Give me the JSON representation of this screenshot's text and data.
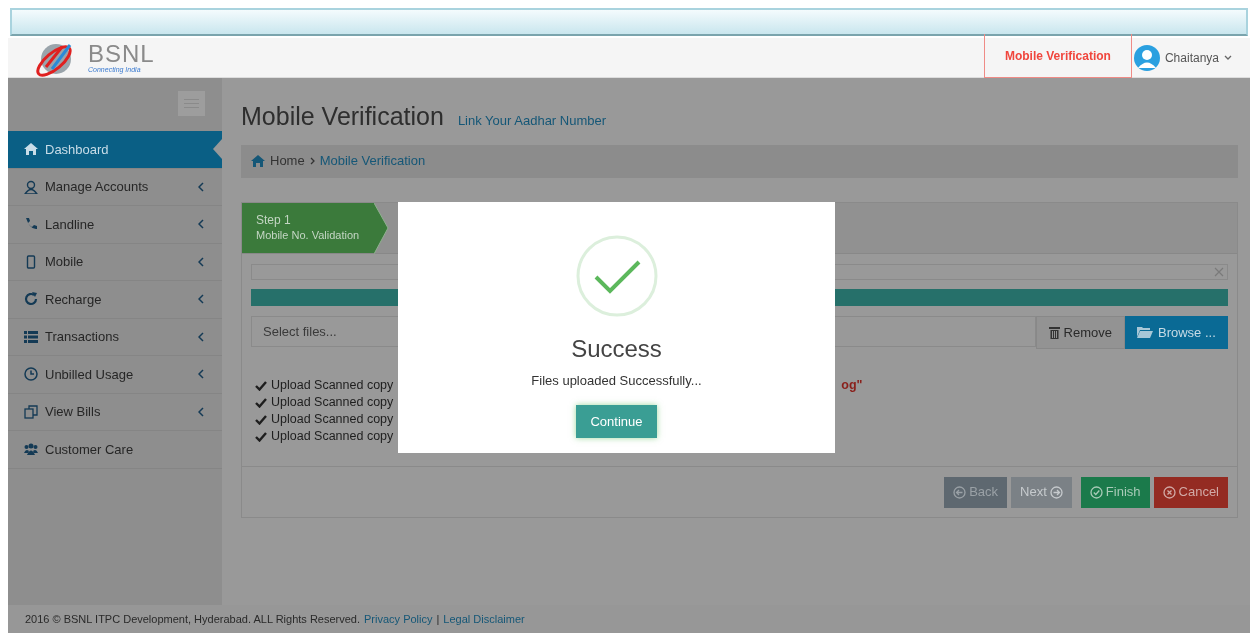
{
  "header": {
    "logo": {
      "name": "BSNL",
      "tagline": "Connecting India"
    },
    "nav_link": {
      "label": "Mobile Verification",
      "selected": true
    },
    "user": {
      "name": "Chaitanya"
    }
  },
  "sidebar": {
    "items": [
      {
        "label": "Dashboard",
        "selected": true,
        "expandable": false
      },
      {
        "label": "Manage Accounts",
        "selected": false,
        "expandable": true
      },
      {
        "label": "Landline",
        "selected": false,
        "expandable": true
      },
      {
        "label": "Mobile",
        "selected": false,
        "expandable": true
      },
      {
        "label": "Recharge",
        "selected": false,
        "expandable": true
      },
      {
        "label": "Transactions",
        "selected": false,
        "expandable": true
      },
      {
        "label": "Unbilled Usage",
        "selected": false,
        "expandable": true
      },
      {
        "label": "View Bills",
        "selected": false,
        "expandable": true
      },
      {
        "label": "Customer Care",
        "selected": false,
        "expandable": false
      }
    ]
  },
  "page": {
    "title": "Mobile Verification",
    "subtitle": "Link Your Aadhar Number"
  },
  "breadcrumb": [
    {
      "label": "Home"
    },
    {
      "label": "Mobile Verification"
    }
  ],
  "wizard": {
    "steps": [
      {
        "title": "Step 1",
        "subtitle": "Mobile No. Validation"
      }
    ],
    "upload": {
      "progress": {
        "level": 1
      },
      "placeholder": "Select files...",
      "remove": "Remove",
      "browse": "Browse ..."
    },
    "checklist": [
      {
        "text": "Upload Scanned copy",
        "note": "og\""
      },
      {
        "text": "Upload Scanned copy"
      },
      {
        "text": "Upload Scanned copy"
      },
      {
        "text": "Upload Scanned copy"
      }
    ],
    "buttons": [
      {
        "label": "Back",
        "kind": "back",
        "disabled": false
      },
      {
        "label": "Next",
        "kind": "next",
        "disabled": true
      },
      {
        "label": "Finish",
        "kind": "finish",
        "disabled": false
      },
      {
        "label": "Cancel",
        "kind": "cancel",
        "disabled": false
      }
    ]
  },
  "modal": {
    "title": "Success",
    "message": "Files uploaded Successfully...",
    "button": "Continue"
  },
  "footer": {
    "text": "2016 © BSNL ITPC Development, Hyderabad. ALL Rights Reserved.",
    "links": [
      "Privacy Policy",
      "Legal Disclaimer"
    ],
    "separator": "|"
  }
}
